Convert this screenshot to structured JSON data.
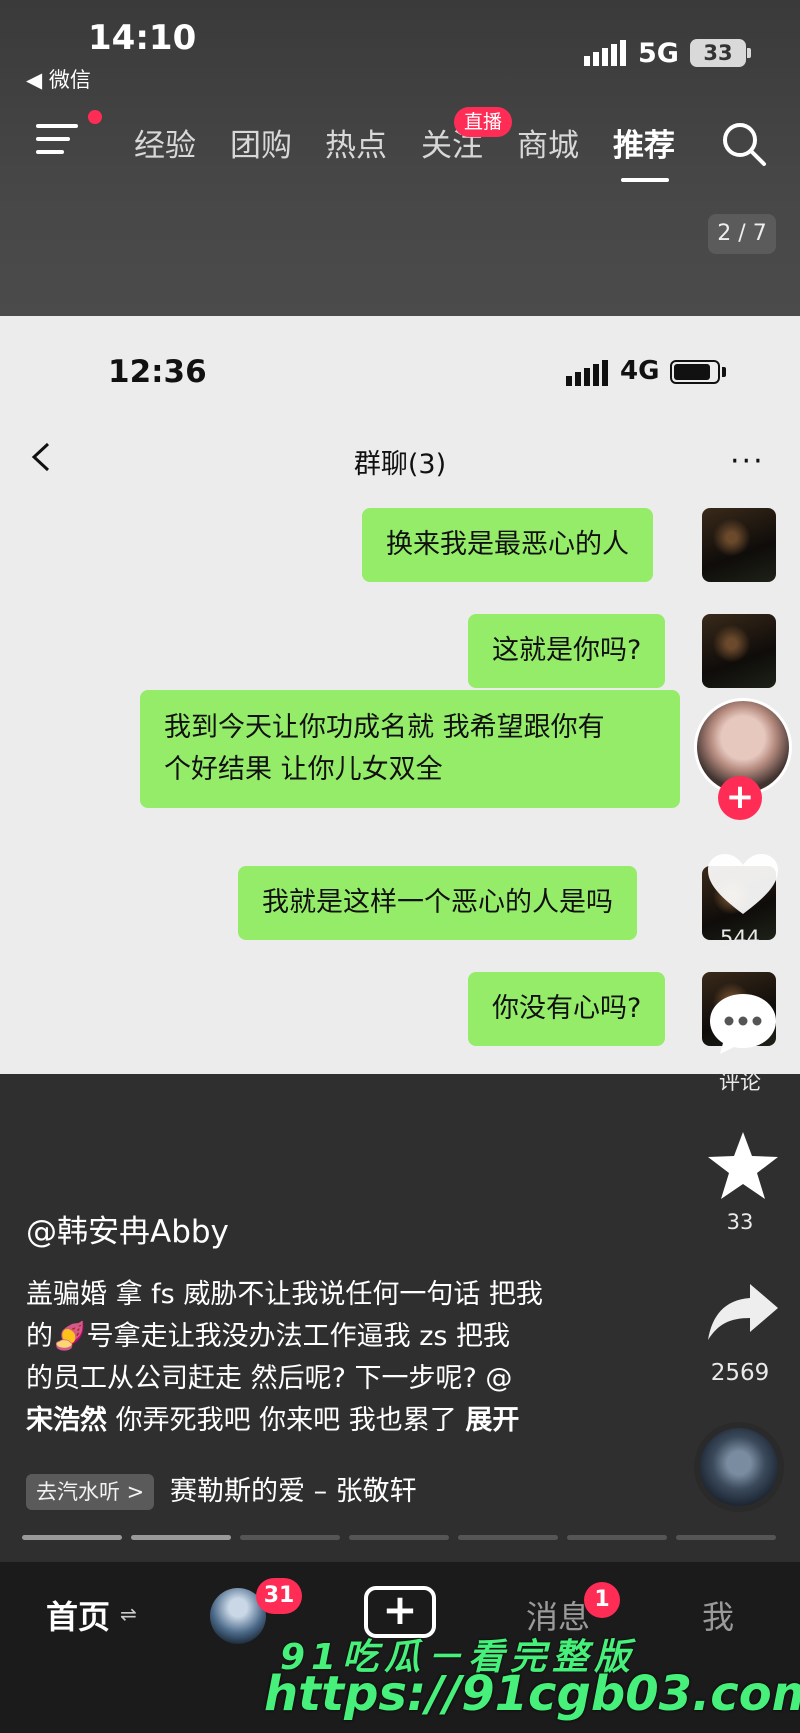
{
  "status_bar": {
    "time": "14:10",
    "back_app": "◀ 微信",
    "network": "5G",
    "battery": "33"
  },
  "top_nav": {
    "tabs": [
      "经验",
      "团购",
      "热点",
      "关注",
      "商城",
      "推荐"
    ],
    "active_tab": "推荐",
    "live_badge": "直播"
  },
  "page_counter": "2 / 7",
  "screenshot": {
    "status_bar": {
      "time": "12:36",
      "network": "4G"
    },
    "chat_title": "群聊(3)",
    "more": "···",
    "messages": [
      "换来我是最恶心的人",
      "这就是你吗?",
      "我到今天让你功成名就 我希望跟你有",
      "个好结果 让你儿女双全",
      "我就是这样一个恶心的人是吗",
      "你没有心吗?"
    ]
  },
  "actions": {
    "follow_plus": "+",
    "like_count": "544",
    "comment_label": "评论",
    "star_count": "33",
    "share_count": "2569"
  },
  "post": {
    "author": "@韩安冉Abby",
    "desc_lines": [
      "盖骗婚 拿 fs 威胁不让我说任何一句话 把我",
      "的🍠号拿走让我没办法工作逼我 zs  把我",
      "的员工从公司赶走 然后呢? 下一步呢? @"
    ],
    "mention": "宋浩然",
    "desc_tail": " 你弄死我吧 你来吧 我也累了 ",
    "expand": "展开",
    "music_tag": "去汽水听 >",
    "music_name": "赛勒斯的爱 – 张敬轩"
  },
  "tabbar": {
    "home": "首页",
    "home_arrows": "⇌",
    "friends_badge": "31",
    "create": "+",
    "messages": "消息",
    "messages_badge": "1",
    "me": "我"
  },
  "watermark": {
    "line1": "91吃瓜－看完整版",
    "line2": "https://91cgb03.com"
  },
  "colors": {
    "accent": "#ff2d55",
    "bubble": "#95ec69",
    "watermark": "#46f07a"
  }
}
